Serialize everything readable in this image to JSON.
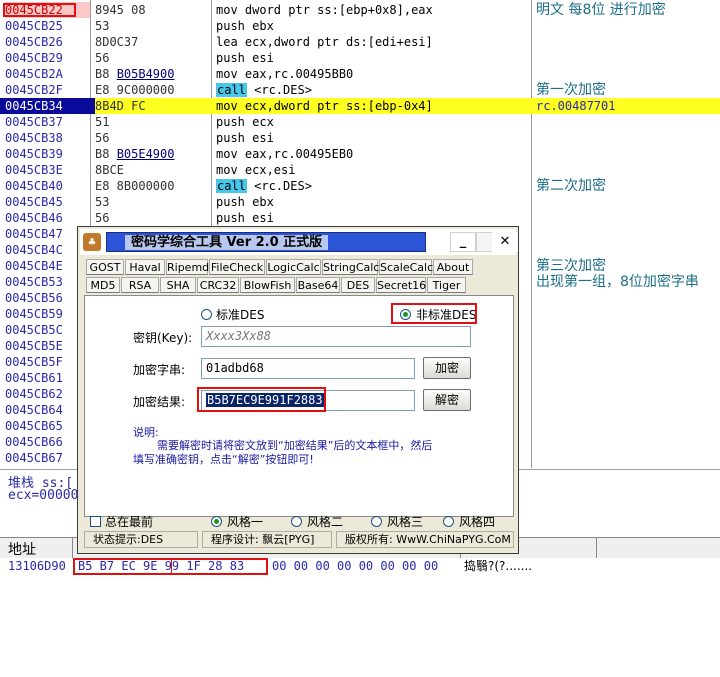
{
  "disasm": {
    "rows": [
      {
        "addr": "0045CB22",
        "hex": "8945 08",
        "hex_link": "",
        "asm": "mov dword ptr ss:[ebp+0x8],eax",
        "comment": "明文 每8位 进行加密"
      },
      {
        "addr": "0045CB25",
        "hex": "53",
        "hex_link": "",
        "asm": "push ebx",
        "comment": ""
      },
      {
        "addr": "0045CB26",
        "hex": "8D0C37",
        "hex_link": "",
        "asm": "lea ecx,dword ptr ds:[edi+esi]",
        "comment": ""
      },
      {
        "addr": "0045CB29",
        "hex": "56",
        "hex_link": "",
        "asm": "push esi",
        "comment": ""
      },
      {
        "addr": "0045CB2A",
        "hex": "B8 ",
        "hex_link": "B05B4900",
        "asm": "mov eax,rc.00495BB0",
        "comment": ""
      },
      {
        "addr": "0045CB2F",
        "hex": "E8 9C000000",
        "hex_link": "",
        "asm": "",
        "call": "call",
        "call_target": " <rc.DES>",
        "comment": "第一次加密"
      },
      {
        "addr": "0045CB34",
        "hex": "8B4D FC",
        "hex_link": "",
        "asm": "mov ecx,dword ptr ss:[ebp-0x4]",
        "comment": "rc.00487701"
      },
      {
        "addr": "0045CB37",
        "hex": "51",
        "hex_link": "",
        "asm": "push ecx",
        "comment": ""
      },
      {
        "addr": "0045CB38",
        "hex": "56",
        "hex_link": "",
        "asm": "push esi",
        "comment": ""
      },
      {
        "addr": "0045CB39",
        "hex": "B8 ",
        "hex_link": "B05E4900",
        "asm": "mov eax,rc.00495EB0",
        "comment": ""
      },
      {
        "addr": "0045CB3E",
        "hex": "8BCE",
        "hex_link": "",
        "asm": "mov ecx,esi",
        "comment": ""
      },
      {
        "addr": "0045CB40",
        "hex": "E8 8B000000",
        "hex_link": "",
        "asm": "",
        "call": "call",
        "call_target": " <rc.DES>",
        "comment": "第二次加密"
      },
      {
        "addr": "0045CB45",
        "hex": "53",
        "hex_link": "",
        "asm": "push ebx",
        "comment": ""
      },
      {
        "addr": "0045CB46",
        "hex": "56",
        "hex_link": "",
        "asm": "push esi",
        "comment": ""
      },
      {
        "addr": "0045CB47",
        "hex": "",
        "hex_link": "",
        "asm": "",
        "comment": ""
      },
      {
        "addr": "0045CB4C",
        "hex": "",
        "hex_link": "",
        "asm": "",
        "comment": ""
      },
      {
        "addr": "0045CB4E",
        "hex": "",
        "hex_link": "",
        "asm": "",
        "comment": "第三次加密"
      },
      {
        "addr": "0045CB53",
        "hex": "",
        "hex_link": "",
        "asm": "",
        "comment": "出现第一组，8位加密字串"
      },
      {
        "addr": "0045CB56",
        "hex": "",
        "hex_link": "",
        "asm": "",
        "comment": ""
      },
      {
        "addr": "0045CB59",
        "hex": "",
        "hex_link": "",
        "asm": "",
        "comment": ""
      },
      {
        "addr": "0045CB5C",
        "hex": "",
        "hex_link": "",
        "asm": "",
        "comment": ""
      },
      {
        "addr": "0045CB5E",
        "hex": "",
        "hex_link": "",
        "asm": "",
        "comment": ""
      },
      {
        "addr": "0045CB5F",
        "hex": "",
        "hex_link": "",
        "asm": "",
        "comment": ""
      },
      {
        "addr": "0045CB61",
        "hex": "",
        "hex_link": "",
        "asm": "",
        "comment": ""
      },
      {
        "addr": "0045CB62",
        "hex": "",
        "hex_link": "",
        "asm": "",
        "comment": ""
      },
      {
        "addr": "0045CB64",
        "hex": "",
        "hex_link": "",
        "asm": "",
        "comment": ""
      },
      {
        "addr": "0045CB65",
        "hex": "",
        "hex_link": "",
        "asm": "",
        "comment": ""
      },
      {
        "addr": "0045CB66",
        "hex": "",
        "hex_link": "",
        "asm": "",
        "comment": ""
      },
      {
        "addr": "0045CB67",
        "hex": "",
        "hex_link": "",
        "asm": "",
        "comment": ""
      }
    ],
    "selected_addr": "0045CB34"
  },
  "stack": {
    "line1": "堆栈 ss:[",
    "line2": "ecx=00000"
  },
  "dump": {
    "header": "地址",
    "addr": "13106D90",
    "bytes_hl": "B5 B7 EC 9E 99 1F 28 83",
    "bytes_rest": "00 00 00 00 00 00 00 00",
    "ascii": "捣翳?(?......."
  },
  "tool": {
    "title": "密码学综合工具 Ver 2.0 正式版",
    "icon": "♣",
    "min_btn": "_",
    "max_btn": "",
    "close_btn": "✕",
    "tabs_row1": [
      "GOST",
      "Haval",
      "Ripemd",
      "FileCheck",
      "LogicCalc",
      "StringCalc",
      "ScaleCalc",
      "About"
    ],
    "tabs_row2": [
      "MD5",
      "RSA",
      "SHA",
      "CRC32",
      "BlowFish",
      "Base64",
      "DES",
      "Secret16",
      "Tiger"
    ],
    "radio_std": "标准DES",
    "radio_nonstd": "非标准DES",
    "key_label": "密钥(Key):",
    "key_value": "Xxxx3Xx88",
    "plain_label": "加密字串:",
    "plain_value": "01adbd68",
    "encrypt_btn": "加密",
    "result_label": "加密结果:",
    "result_value": "B5B7EC9E991F2883",
    "decrypt_btn": "解密",
    "note_title": "说明:",
    "note_line1": "需要解密时请将密文放到“加密结果”后的文本框中，然后",
    "note_line2": "填写准确密钥，点击“解密”按钮即可!",
    "ontop_label": "总在最前",
    "styles": [
      "风格一",
      "风格二",
      "风格三",
      "风格四"
    ],
    "status_left": "状态提示:DES",
    "status_mid": "程序设计: 飘云[PYG]",
    "status_right": "版权所有: WwW.ChiNaPYG.CoM"
  }
}
